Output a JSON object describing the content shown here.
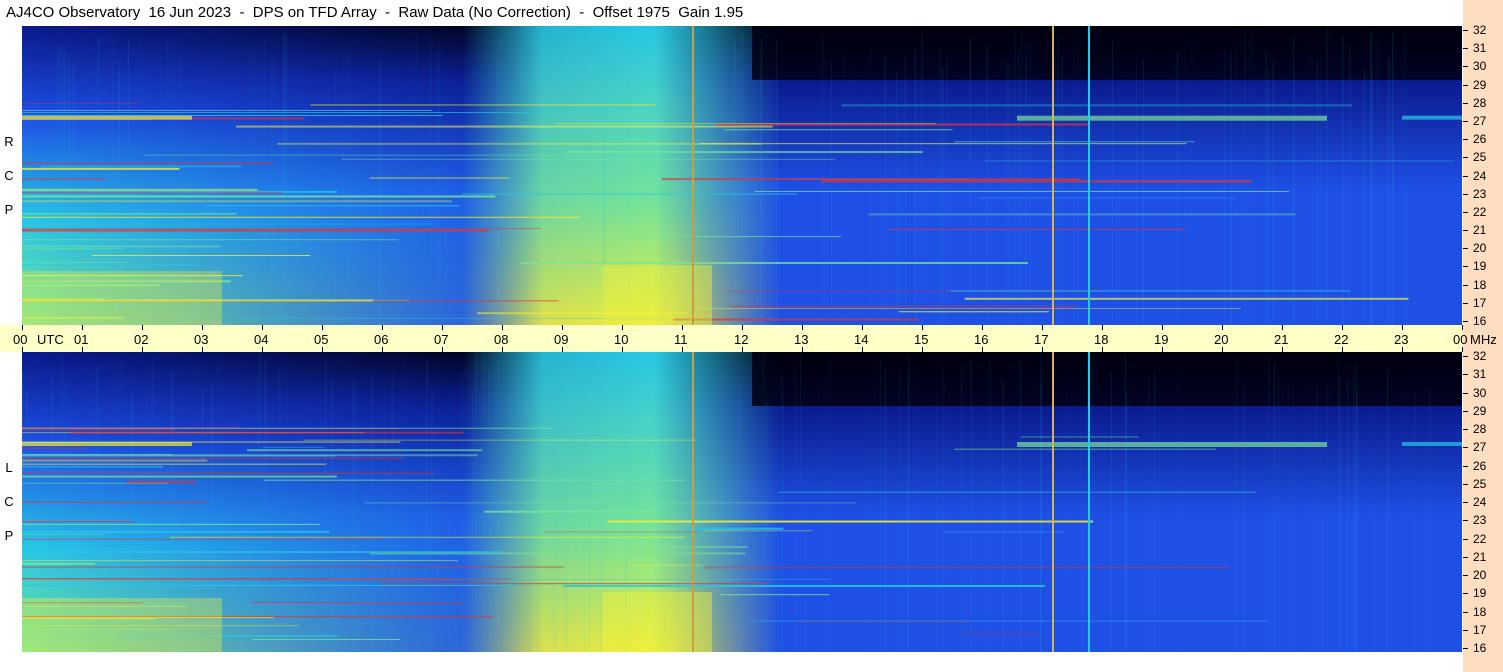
{
  "title": "AJ4CO Observatory  16 Jun 2023  -  DPS on TFD Array  -  Raw Data (No Correction)  -  Offset 1975  Gain 1.95",
  "panels": [
    {
      "name": "rcp",
      "label": [
        "R",
        "C",
        "P"
      ]
    },
    {
      "name": "lcp",
      "label": [
        "L",
        "C",
        "P"
      ]
    }
  ],
  "time_axis": {
    "first": "00",
    "utc": "UTC",
    "labels": [
      "01",
      "02",
      "03",
      "04",
      "05",
      "06",
      "07",
      "08",
      "09",
      "10",
      "11",
      "12",
      "13",
      "14",
      "15",
      "16",
      "17",
      "18",
      "19",
      "20",
      "21",
      "22",
      "23"
    ],
    "last": "00",
    "unit": "MHz"
  },
  "freq_axis": [
    "32",
    "31",
    "30",
    "29",
    "28",
    "27",
    "26",
    "25",
    "24",
    "23",
    "22",
    "21",
    "20",
    "19",
    "18",
    "17",
    "16"
  ],
  "colors": {
    "background": "#000010",
    "deep_blue": "#0a1a8c",
    "blue": "#1e50e6",
    "cyan": "#28c8e6",
    "green": "#78e696",
    "yellow": "#f0f03c",
    "red": "#e63232",
    "axis_band": "#ffffc8",
    "right_strip": "#ffddc0"
  }
}
